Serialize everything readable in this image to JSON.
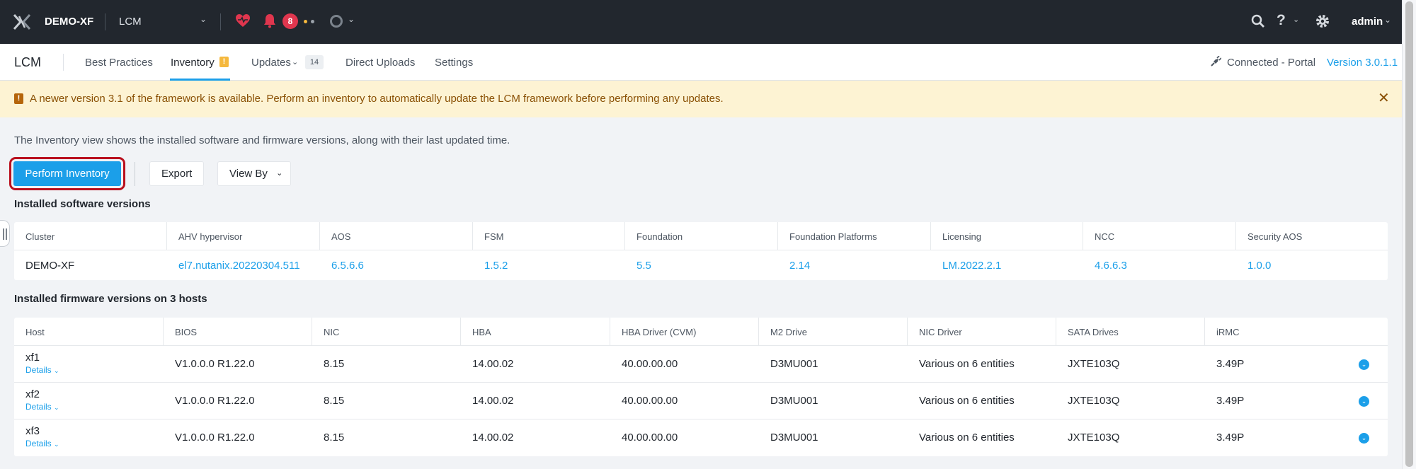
{
  "topbar": {
    "cluster_name": "DEMO-XF",
    "app_selector": "LCM",
    "alert_count": "8",
    "user": "admin",
    "colors": {
      "background": "#22272e",
      "badge": "#e0364e",
      "heart": "#e0364e"
    }
  },
  "subnav": {
    "title": "LCM",
    "tabs": [
      {
        "label": "Best Practices"
      },
      {
        "label": "Inventory"
      },
      {
        "label": "Updates"
      },
      {
        "label": "Direct Uploads"
      },
      {
        "label": "Settings"
      }
    ],
    "inventory_badge": "!",
    "updates_count": "14",
    "connection": "Connected - Portal",
    "version": "Version 3.0.1.1"
  },
  "banner": {
    "icon": "!",
    "text": "A newer version 3.1 of the framework is available. Perform an inventory to automatically update the LCM framework before performing any updates."
  },
  "description": "The Inventory view shows the installed software and firmware versions, along with their last updated time.",
  "toolbar": {
    "perform_inventory": "Perform Inventory",
    "export": "Export",
    "view_by": "View By"
  },
  "software": {
    "title": "Installed software versions",
    "headers": [
      "Cluster",
      "AHV hypervisor",
      "AOS",
      "FSM",
      "Foundation",
      "Foundation Platforms",
      "Licensing",
      "NCC",
      "Security AOS"
    ],
    "row": [
      "DEMO-XF",
      "el7.nutanix.20220304.511",
      "6.5.6.6",
      "1.5.2",
      "5.5",
      "2.14",
      "LM.2022.2.1",
      "4.6.6.3",
      "1.0.0"
    ]
  },
  "firmware": {
    "title": "Installed firmware versions on 3 hosts",
    "headers": [
      "Host",
      "BIOS",
      "NIC",
      "HBA",
      "HBA Driver (CVM)",
      "M2 Drive",
      "NIC Driver",
      "SATA Drives",
      "iRMC"
    ],
    "details_label": "Details",
    "rows": [
      {
        "host": "xf1",
        "values": [
          "V1.0.0.0 R1.22.0",
          "8.15",
          "14.00.02",
          "40.00.00.00",
          "D3MU001",
          "Various on 6 entities",
          "JXTE103Q",
          "3.49P"
        ]
      },
      {
        "host": "xf2",
        "values": [
          "V1.0.0.0 R1.22.0",
          "8.15",
          "14.00.02",
          "40.00.00.00",
          "D3MU001",
          "Various on 6 entities",
          "JXTE103Q",
          "3.49P"
        ]
      },
      {
        "host": "xf3",
        "values": [
          "V1.0.0.0 R1.22.0",
          "8.15",
          "14.00.02",
          "40.00.00.00",
          "D3MU001",
          "Various on 6 entities",
          "JXTE103Q",
          "3.49P"
        ]
      }
    ]
  },
  "colors": {
    "accent": "#1b9fe9",
    "warning_bg": "#fdf3d3",
    "warning_text": "#8a5004",
    "highlight_outline": "#b9101e"
  }
}
